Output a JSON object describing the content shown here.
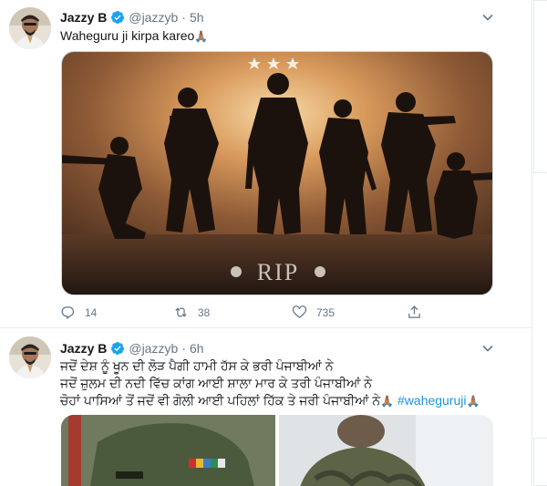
{
  "tweets": [
    {
      "name": "Jazzy B",
      "handle": "@jazzyb",
      "separator": "·",
      "time": "5h",
      "text": "Waheguru ji kirpa kareo",
      "emoji": "🙏🏽",
      "image_caption": "RIP",
      "stats": {
        "replies": "14",
        "retweets": "38",
        "likes": "735"
      }
    },
    {
      "name": "Jazzy B",
      "handle": "@jazzyb",
      "separator": "·",
      "time": "6h",
      "lines": [
        "ਜਦੋਂ ਦੇਸ਼ ਨੂੰ ਖੂਨ ਦੀ ਲੋੜ ਪੈਗੀ ਹਾਮੀ ਹੱਸ ਕੇ ਭਰੀ ਪੰਜਾਬੀਆਂ ਨੇ",
        "ਜਦੋਂ ਜ਼ੁਲਮ ਦੀ ਨਦੀ ਵਿੱਚ ਕਾਂਗ ਆਈ ਸ਼ਾਲਾ ਮਾਰ ਕੇ ਤਰੀ ਪੰਜਾਬੀਆਂ ਨੇ",
        "ਚੋਹਾਂ ਪਾਸਿਆਂ ਤੋਂ ਜਦੋਂ ਵੀ ਗੋਲੀ ਆਈ ਪਹਿਲਾਂ ਹਿੱਕ ਤੇ ਜਰੀ ਪੰਜਾਬੀਆਂ ਨੇ"
      ],
      "emoji": "🙏🏽",
      "hashtag": "#waheguruji"
    }
  ],
  "icons": {
    "verified": "verified-badge-icon",
    "caret": "chevron-down-icon",
    "reply": "reply-icon",
    "retweet": "retweet-icon",
    "like": "heart-icon",
    "share": "share-icon"
  },
  "colors": {
    "accent": "#1da1f2",
    "secondary_text": "#657786",
    "hashtag": "#1b95e0"
  }
}
